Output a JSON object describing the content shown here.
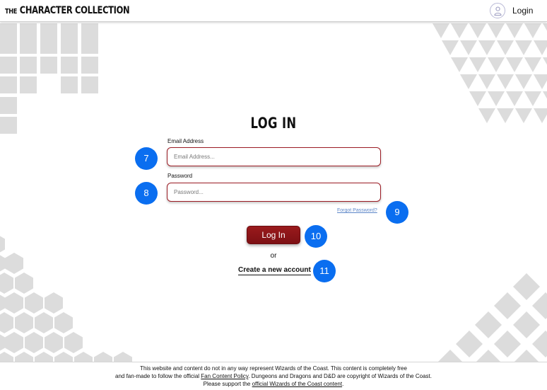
{
  "header": {
    "brand_prefix": "THE",
    "brand_name": "CHARACTER COLLECTION",
    "login_label": "Login"
  },
  "form": {
    "title": "LOG IN",
    "email_label": "Email Address",
    "email_placeholder": "Email Address...",
    "email_value": "",
    "password_label": "Password",
    "password_placeholder": "Password...",
    "password_value": "",
    "forgot_label": "Forgot Password?",
    "login_button": "Log In",
    "or_text": "or",
    "create_account_label": "Create a new account"
  },
  "badges": [
    "7",
    "8",
    "9",
    "10",
    "11"
  ],
  "footer": {
    "line1": "This website and content do not in any way represent Wizards of the Coast. This content is completely free",
    "line2_pre": "and fan-made to follow the official ",
    "line2_link": "Fan Content Policy",
    "line2_post": ". Dungeons and Dragons and D&D are copyright of Wizards of the Coast.",
    "line3_pre": "Please support the ",
    "line3_link": "official Wizards of the Coast content",
    "line3_post": "."
  },
  "colors": {
    "accent": "#8b1519",
    "badge": "#0a6ef0",
    "link": "#5c86c8",
    "decor": "#dcdcdc"
  }
}
